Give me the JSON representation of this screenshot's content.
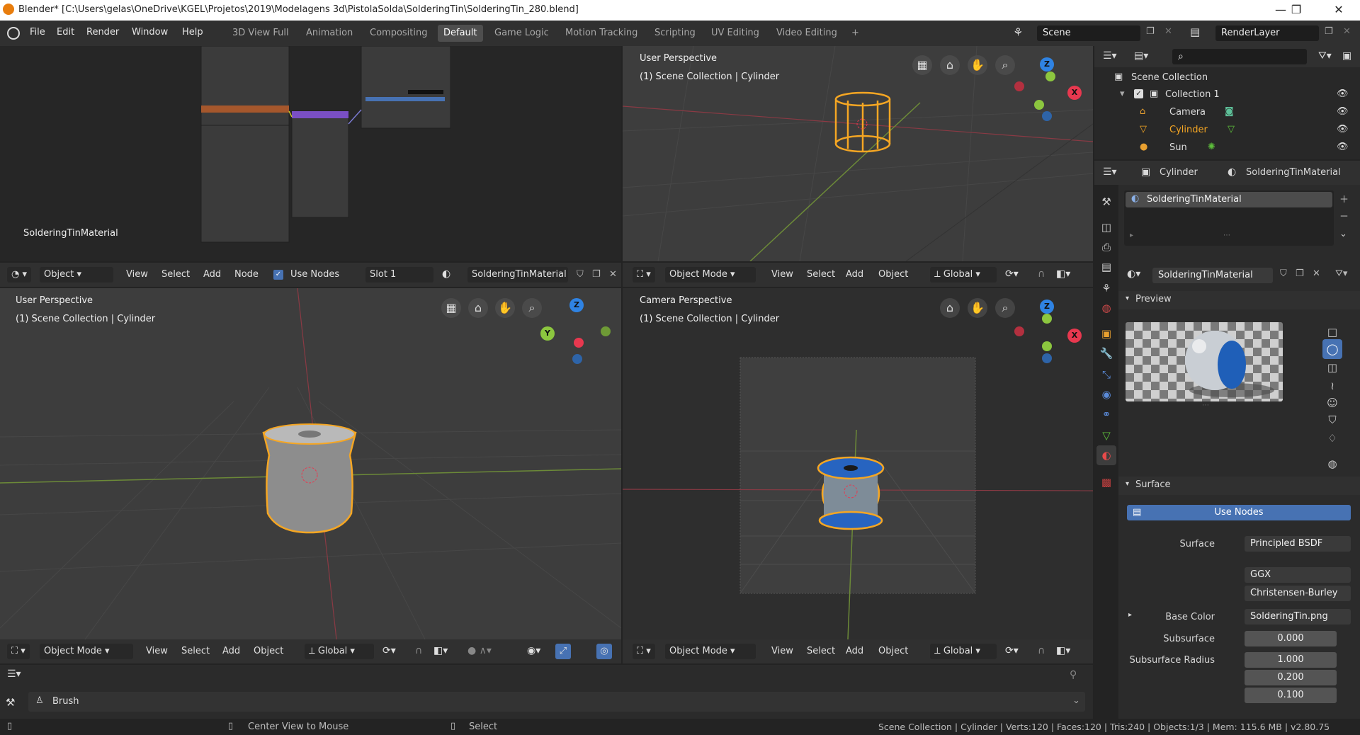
{
  "window": {
    "title": "Blender* [C:\\Users\\gelas\\OneDrive\\KGEL\\Projetos\\2019\\Modelagens 3d\\PistolaSolda\\SolderingTin\\SolderingTin_280.blend]",
    "minimize": "—",
    "maximize": "❐",
    "close": "✕"
  },
  "menu": [
    "File",
    "Edit",
    "Render",
    "Window",
    "Help"
  ],
  "workspaces": [
    "3D View Full",
    "Animation",
    "Compositing",
    "Default",
    "Game Logic",
    "Motion Tracking",
    "Scripting",
    "UV Editing",
    "Video Editing",
    "+"
  ],
  "active_workspace": "Default",
  "scene": {
    "label": "Scene",
    "render_layer": "RenderLayer"
  },
  "node_editor": {
    "material_label": "SolderingTinMaterial",
    "header": {
      "object": "Object",
      "view": "View",
      "select": "Select",
      "add": "Add",
      "node": "Node",
      "use_nodes": "Use Nodes",
      "slot": "Slot 1",
      "material": "SolderingTinMaterial"
    }
  },
  "viewport_tr": {
    "title": "User Perspective",
    "subtitle": "(1) Scene Collection | Cylinder",
    "header": {
      "mode": "Object Mode",
      "view": "View",
      "select": "Select",
      "add": "Add",
      "object": "Object",
      "transform": "Global"
    }
  },
  "viewport_bl": {
    "title": "User Perspective",
    "subtitle": "(1) Scene Collection | Cylinder",
    "header": {
      "mode": "Object Mode",
      "view": "View",
      "select": "Select",
      "add": "Add",
      "object": "Object",
      "transform": "Global"
    }
  },
  "viewport_br": {
    "title": "Camera Perspective",
    "subtitle": "(1) Scene Collection | Cylinder",
    "header": {
      "mode": "Object Mode",
      "view": "View",
      "select": "Select",
      "add": "Add",
      "object": "Object",
      "transform": "Global"
    }
  },
  "gizmo": {
    "x": "X",
    "y": "Y",
    "z": "Z"
  },
  "outliner": {
    "root": "Scene Collection",
    "collection": "Collection 1",
    "items": [
      {
        "name": "Camera",
        "icon": "camera-icon",
        "color": "#ddd"
      },
      {
        "name": "Cylinder",
        "icon": "mesh-icon",
        "color": "#f5a623"
      },
      {
        "name": "Sun",
        "icon": "light-icon",
        "color": "#ddd"
      }
    ]
  },
  "properties": {
    "breadcrumb_object": "Cylinder",
    "breadcrumb_material": "SolderingTinMaterial",
    "slot_material": "SolderingTinMaterial",
    "material_field": "SolderingTinMaterial",
    "preview_label": "Preview",
    "surface_label": "Surface",
    "use_nodes": "Use Nodes",
    "rows": [
      {
        "label": "Surface",
        "value": "Principled BSDF"
      },
      {
        "label": "",
        "value": "GGX"
      },
      {
        "label": "",
        "value": "Christensen-Burley"
      },
      {
        "label": "Base Color",
        "value": "SolderingTin.png"
      },
      {
        "label": "Subsurface",
        "value": "0.000"
      },
      {
        "label": "Subsurface Radius",
        "value": "1.000"
      },
      {
        "label": "",
        "value": "0.200"
      },
      {
        "label": "",
        "value": "0.100"
      }
    ]
  },
  "tool_settings": {
    "brush": "Brush"
  },
  "status": {
    "center_view": "Center View to Mouse",
    "select": "Select",
    "info": "Scene Collection | Cylinder | Verts:120 | Faces:120 | Tris:240 | Objects:1/3 | Mem: 115.6 MB | v2.80.75"
  },
  "colors": {
    "accent": "#4772b3",
    "selection": "#f5a623",
    "axis_x": "#e8384f",
    "axis_y": "#8cc63f",
    "axis_z": "#2f83e3"
  }
}
